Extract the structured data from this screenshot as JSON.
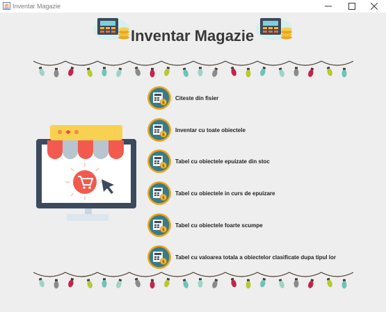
{
  "window": {
    "title": "Inventar Magazie",
    "controls": [
      "minimize-icon",
      "maximize-icon",
      "close-icon"
    ]
  },
  "header": {
    "title": "Inventar Magazie",
    "left_icon": "cash-register-icon",
    "right_icon": "cash-register-icon"
  },
  "decorations": {
    "top": "christmas-lights-garland",
    "bottom": "christmas-lights-garland",
    "illustration": "online-store-monitor-illustration",
    "light_colors": [
      "#9fd3c7",
      "#8a8a8a",
      "#c8224a",
      "#b7c930",
      "#6fc3b8"
    ]
  },
  "menu": {
    "button_icon": "cash-register-icon",
    "items": [
      {
        "label": "Citeste din fisier"
      },
      {
        "label": "Inventar cu toate obiectele"
      },
      {
        "label": "Tabel cu obiectele epuizate din stoc"
      },
      {
        "label": "Tabel cu obiectele in curs de epuizare"
      },
      {
        "label": "Tabel cu obiectele foarte scumpe"
      },
      {
        "label": "Tabel cu valoarea totala a obiectelor clasificate dupa tipul lor"
      }
    ]
  },
  "colors": {
    "window_bg": "#eeeeee",
    "title_text": "#383838",
    "button_ring": "#e8a826",
    "button_fill": "#3f7a82"
  }
}
